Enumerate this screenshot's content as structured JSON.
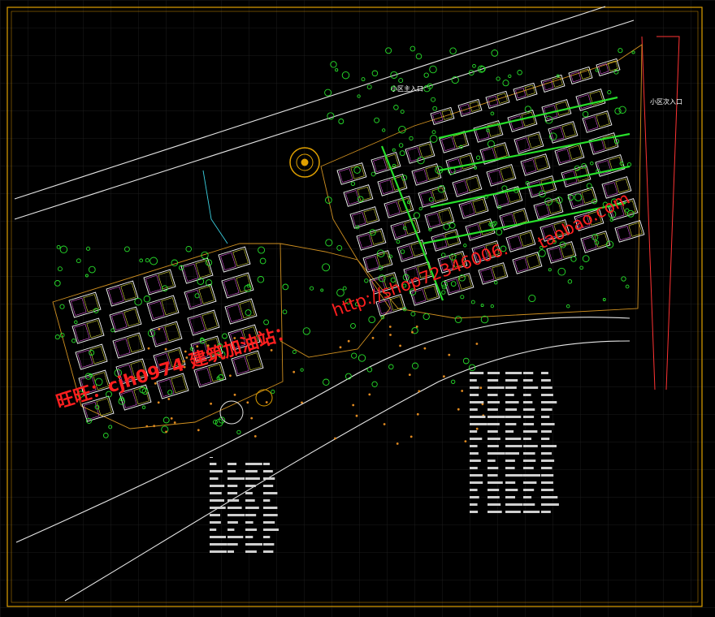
{
  "colors": {
    "background": "#000000",
    "frame": "#e0a000",
    "grid": "#1c1c1c",
    "road": "#e6e6e6",
    "building": "#ffffff",
    "tree": "#27e02b",
    "watermark": "#ff1f1f",
    "boundary": "#ff3333"
  },
  "labels": {
    "main_entrance": "小区主入口",
    "secondary_entrance": "小区次入口"
  },
  "watermark": {
    "line1": "旺旺：cjh0974 建筑加油站：",
    "url_a": "http://shop72346006.",
    "url_b": "taobao.com"
  }
}
